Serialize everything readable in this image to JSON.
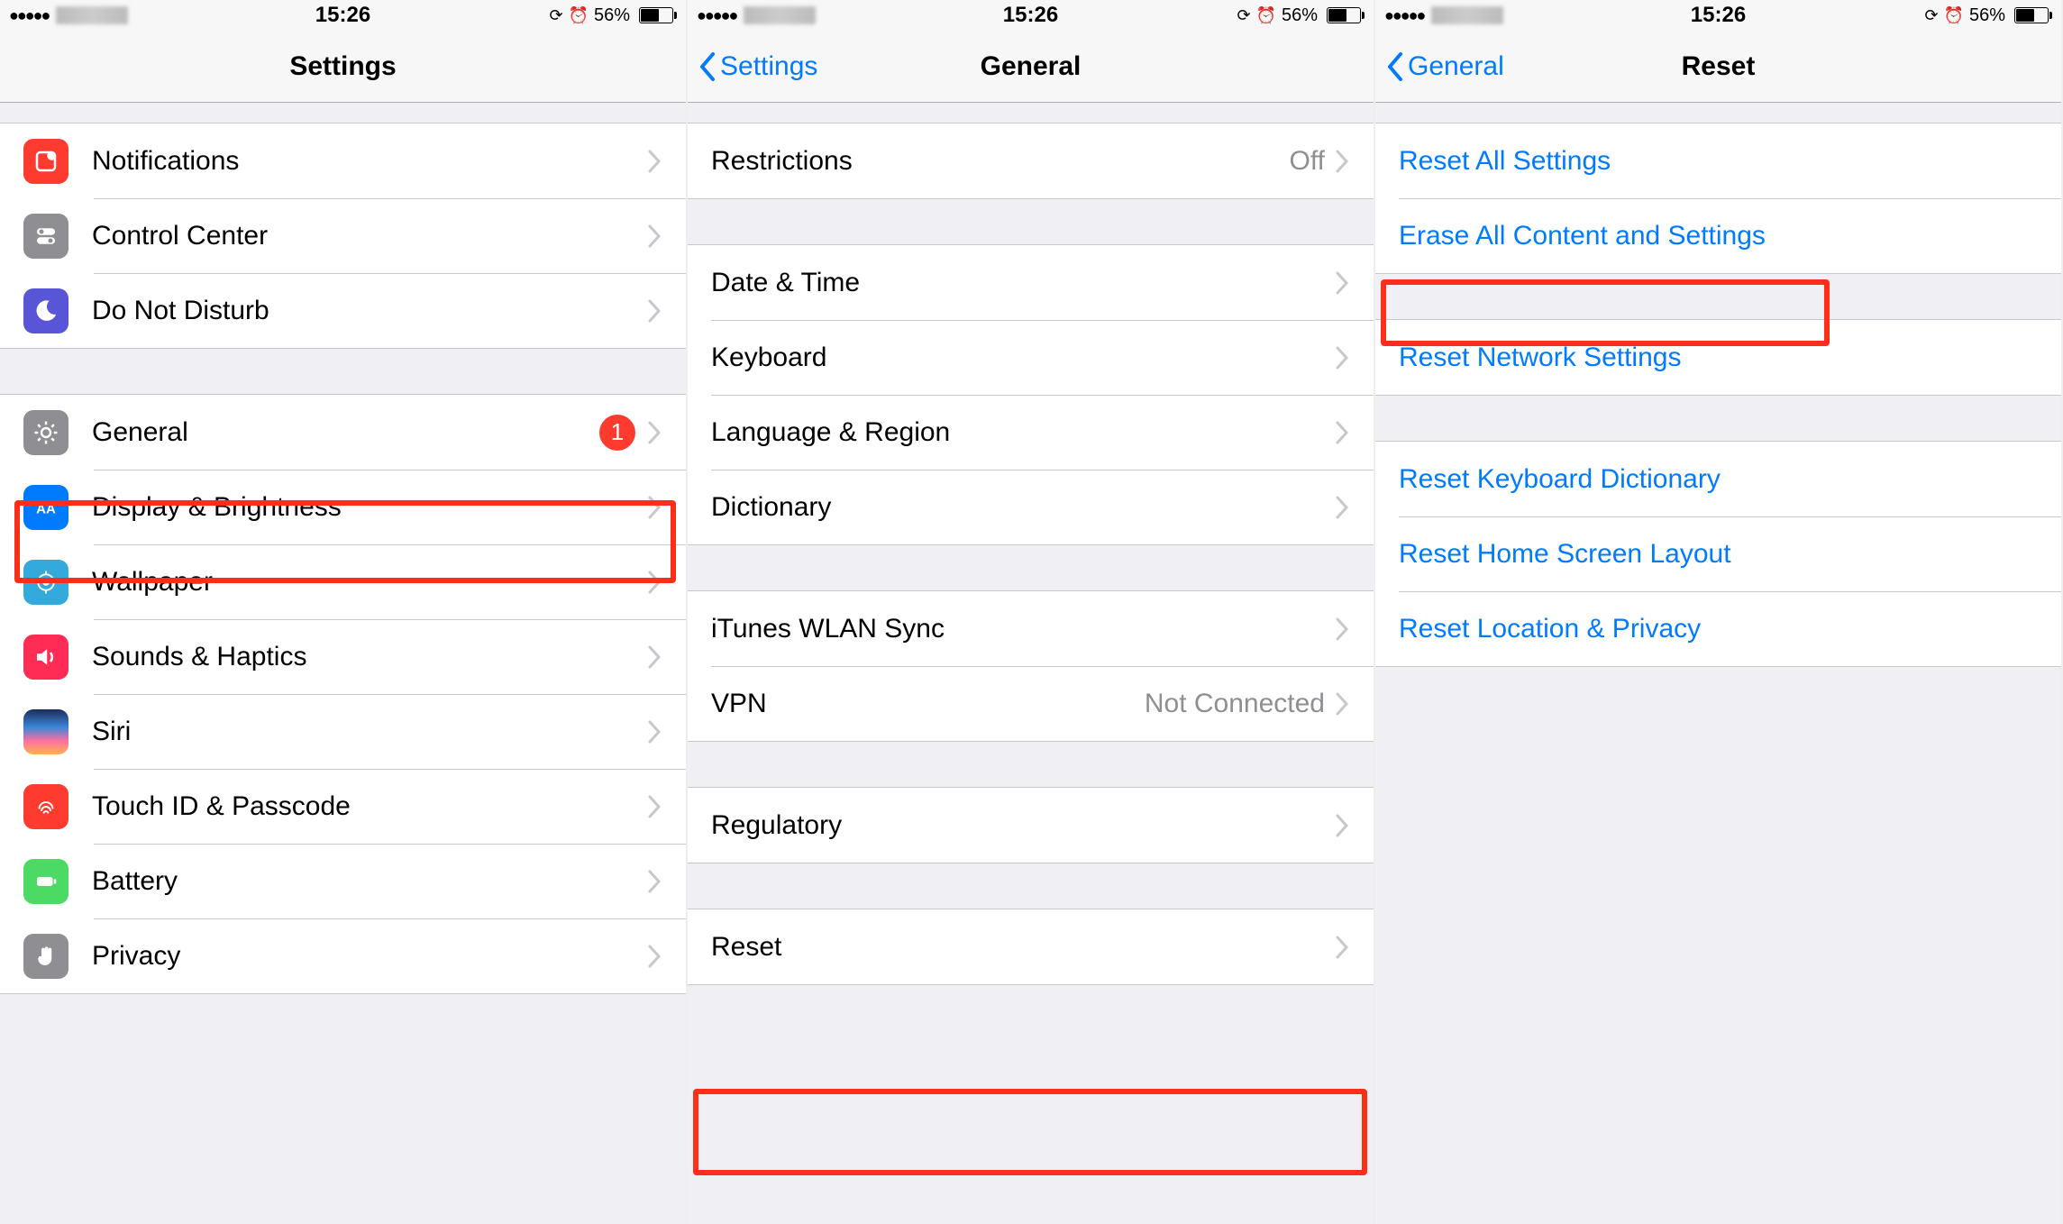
{
  "status": {
    "time": "15:26",
    "battery_pct": "56%"
  },
  "screen1": {
    "title": "Settings",
    "rows": {
      "notifications": "Notifications",
      "control_center": "Control Center",
      "dnd": "Do Not Disturb",
      "general": "General",
      "general_badge": "1",
      "display": "Display & Brightness",
      "wallpaper": "Wallpaper",
      "sounds": "Sounds & Haptics",
      "siri": "Siri",
      "touchid": "Touch ID & Passcode",
      "battery": "Battery",
      "privacy": "Privacy"
    }
  },
  "screen2": {
    "back": "Settings",
    "title": "General",
    "rows": {
      "restrictions": "Restrictions",
      "restrictions_val": "Off",
      "date_time": "Date & Time",
      "keyboard": "Keyboard",
      "lang_region": "Language & Region",
      "dictionary": "Dictionary",
      "itunes_sync": "iTunes WLAN Sync",
      "vpn": "VPN",
      "vpn_val": "Not Connected",
      "regulatory": "Regulatory",
      "reset": "Reset"
    }
  },
  "screen3": {
    "back": "General",
    "title": "Reset",
    "rows": {
      "reset_all": "Reset All Settings",
      "erase_all": "Erase All Content and Settings",
      "reset_network": "Reset Network Settings",
      "reset_keyboard": "Reset Keyboard Dictionary",
      "reset_home": "Reset Home Screen Layout",
      "reset_location": "Reset Location & Privacy"
    }
  }
}
